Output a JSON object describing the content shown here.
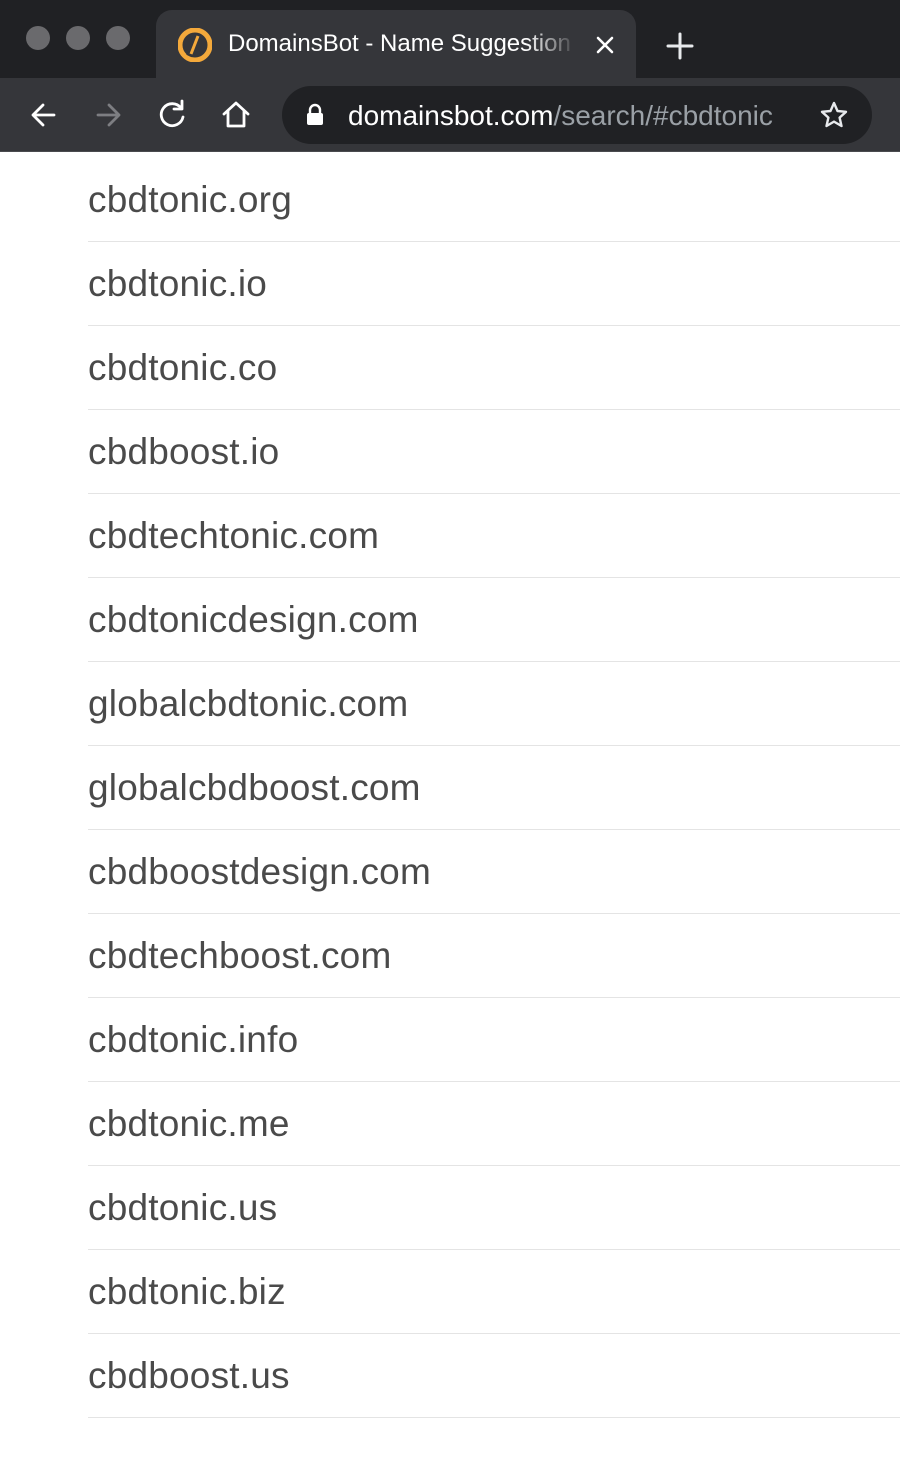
{
  "window": {
    "controls": [
      "close",
      "minimize",
      "zoom"
    ]
  },
  "tab": {
    "title": "DomainsBot - Name Suggestion",
    "favicon": "domainsbot-logo-icon",
    "favicon_color": "#f4a93b"
  },
  "toolbar": {
    "url_host": "domainsbot.com",
    "url_path": "/search/#cbdtonic",
    "icons": [
      "back-arrow-icon",
      "forward-arrow-icon",
      "reload-icon",
      "home-icon",
      "lock-icon",
      "star-icon"
    ]
  },
  "domains": [
    "cbdtonic.org",
    "cbdtonic.io",
    "cbdtonic.co",
    "cbdboost.io",
    "cbdtechtonic.com",
    "cbdtonicdesign.com",
    "globalcbdtonic.com",
    "globalcbdboost.com",
    "cbdboostdesign.com",
    "cbdtechboost.com",
    "cbdtonic.info",
    "cbdtonic.me",
    "cbdtonic.us",
    "cbdtonic.biz",
    "cbdboost.us"
  ],
  "colors": {
    "chrome_dark": "#202124",
    "chrome_tab": "#35363a",
    "text_domain": "#4a4a4a",
    "divider": "#e4e4e4"
  }
}
